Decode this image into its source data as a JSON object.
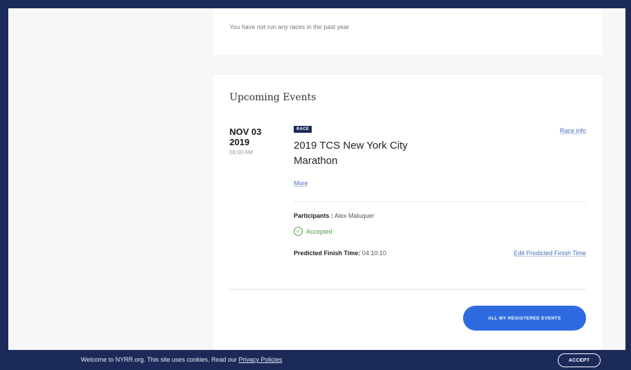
{
  "past_races": {
    "message": "You have not run any races in the past year"
  },
  "upcoming": {
    "title": "Upcoming Events",
    "event": {
      "date_line1": "NOV 03",
      "date_line2": "2019",
      "time": "08:00 AM",
      "badge": "RACE",
      "name": "2019 TCS New York City Marathon",
      "race_info_label": "Race info",
      "more_label": "More",
      "participants_label": "Participants :",
      "participants_value": "Alex Maluquer",
      "status": "Accepted",
      "predicted_label": "Predicted Finish Time:",
      "predicted_value": "04:10:10",
      "edit_label": "Edit Predicted Finish Time"
    },
    "all_events_button": "ALL MY REGISTERED EVENTS"
  },
  "cookie_bar": {
    "text": "Welcome to NYRR.org. This site uses cookies. Read our",
    "privacy_link": "Privacy Policies",
    "accept_button": "ACCEPT"
  },
  "colors": {
    "navy": "#1b2a59",
    "accent_blue": "#2e6be0",
    "link_blue": "#4a6fb6",
    "success_green": "#4f9a4a"
  },
  "icons": {
    "status_icon": "check-circle-icon"
  }
}
